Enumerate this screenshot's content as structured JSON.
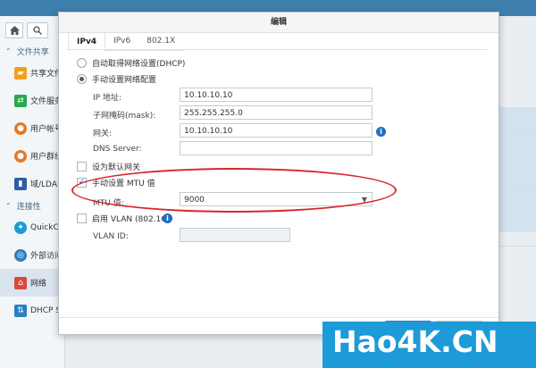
{
  "dialog": {
    "title": "编辑",
    "tabs": [
      {
        "label": "IPv4",
        "active": true
      },
      {
        "label": "IPv6",
        "active": false
      },
      {
        "label": "802.1X",
        "active": false
      }
    ],
    "dhcp_option": "自动取得网络设置(DHCP)",
    "manual_option": "手动设置网络配置",
    "ip_label": "IP 地址:",
    "ip_value": "10.10.10.10",
    "mask_label": "子网掩码(mask):",
    "mask_value": "255.255.255.0",
    "gateway_label": "网关:",
    "gateway_value": "10.10.10.10",
    "dns_label": "DNS Server:",
    "dns_value": "",
    "default_gateway_label": "设为默认网关",
    "mtu_manual_label": "手动设置 MTU 值",
    "mtu_label": "MTU 值:",
    "mtu_value": "9000",
    "vlan_label": "启用 VLAN (802.1Q)",
    "vlan_id_label": "VLAN ID:",
    "vlan_id_value": ""
  },
  "sidebar": {
    "groups": [
      {
        "label": "文件共享"
      },
      {
        "label": "连接性"
      }
    ],
    "items": [
      {
        "label": "共享文件夹",
        "icon": "shared-folder-icon",
        "color": "#f0a020"
      },
      {
        "label": "文件服务",
        "icon": "file-services-icon",
        "color": "#2aa84a"
      },
      {
        "label": "用户帐号",
        "icon": "user-icon",
        "color": "#e07a2c"
      },
      {
        "label": "用户群组",
        "icon": "group-icon",
        "color": "#e07a2c"
      },
      {
        "label": "域/LDAP",
        "icon": "domain-icon",
        "color": "#2b5ea8"
      },
      {
        "label": "QuickConnect",
        "icon": "quickconnect-icon",
        "color": "#1d9ad8"
      },
      {
        "label": "外部访问",
        "icon": "external-access-icon",
        "color": "#2a7fc0"
      },
      {
        "label": "网络",
        "icon": "network-icon",
        "color": "#d84a3a"
      },
      {
        "label": "DHCP Server",
        "icon": "dhcp-icon",
        "color": "#2a7fc0"
      }
    ]
  },
  "watermark": {
    "text": "Hao4K.CN"
  }
}
